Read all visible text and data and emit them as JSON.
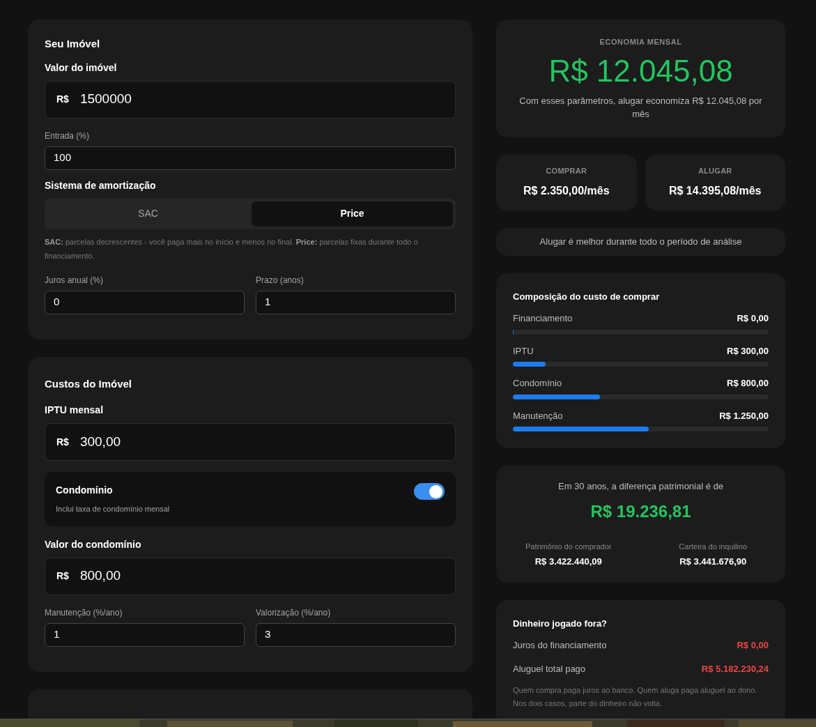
{
  "property": {
    "title": "Seu Imóvel",
    "price": {
      "label": "Valor do imóvel",
      "prefix": "R$",
      "value": "1500000"
    },
    "down": {
      "label": "Entrada (%)",
      "value": "100"
    },
    "amortization": {
      "label": "Sistema de amortização",
      "options": [
        {
          "label": "SAC",
          "selected": false
        },
        {
          "label": "Price",
          "selected": true
        }
      ],
      "note": "**SAC:** parcelas decrescentes - você paga mais no início e menos no final. **Price:** parcelas fixas durante todo o financiamento."
    },
    "pair": [
      {
        "label": "Juros anual (%)",
        "value": "0"
      },
      {
        "label": "Prazo (anos)",
        "value": "1"
      }
    ]
  },
  "costs": {
    "title": "Custos do Imóvel",
    "iptu": {
      "label": "IPTU mensal",
      "prefix": "R$",
      "value": "300,00"
    },
    "condo_toggle": {
      "title": "Condomínio",
      "subtitle": "Inclui taxa de condomínio mensal",
      "on": true
    },
    "condo": {
      "label": "Valor do condomínio",
      "prefix": "R$",
      "value": "800,00"
    },
    "pair": [
      {
        "label": "Manutenção (%/ano)",
        "value": "1"
      },
      {
        "label": "Valorização (%/ano)",
        "value": "3"
      }
    ]
  },
  "savings": {
    "label": "ECONOMIA MENSAL",
    "amount": "R$ 12.045,08",
    "text": "Com esses parâmetros, alugar economiza R$ 12.045,08 por mês"
  },
  "compare": [
    {
      "label": "COMPRAR",
      "value": "R$ 2.350,00/mês"
    },
    {
      "label": "ALUGAR",
      "value": "R$ 14.395,08/mês"
    }
  ],
  "verdict": "Alugar é melhor durante todo o período de análise",
  "composition": {
    "title": "Composição do custo de comprar",
    "items": [
      {
        "label": "Financiamento",
        "value": "R$ 0,00",
        "level": 0
      },
      {
        "label": "IPTU",
        "value": "R$ 300,00",
        "level": 0.128
      },
      {
        "label": "Condomínio",
        "value": "R$ 800,00",
        "level": 0.34
      },
      {
        "label": "Manutenção",
        "value": "R$ 1.250,00",
        "level": 0.532
      }
    ]
  },
  "wealth": {
    "caption": "Em 30 anos, a diferença patrimonial é de",
    "amount": "R$ 19.236,81",
    "items": [
      {
        "label": "Patrimônio do comprador",
        "value": "R$ 3.422.440,09"
      },
      {
        "label": "Carteira do inquilino",
        "value": "R$ 3.441.676,90"
      }
    ]
  },
  "wasted": {
    "title": "Dinheiro jogado fora?",
    "items": [
      {
        "label": "Juros do financiamento",
        "value": "R$ 0,00"
      },
      {
        "label": "Aluguel total pago",
        "value": "R$ 5.182.230,24"
      }
    ],
    "note": "Quem compra paga juros ao banco. Quem aluga paga aluguel ao dono. Nos dois casos, parte do dinheiro não volta."
  }
}
